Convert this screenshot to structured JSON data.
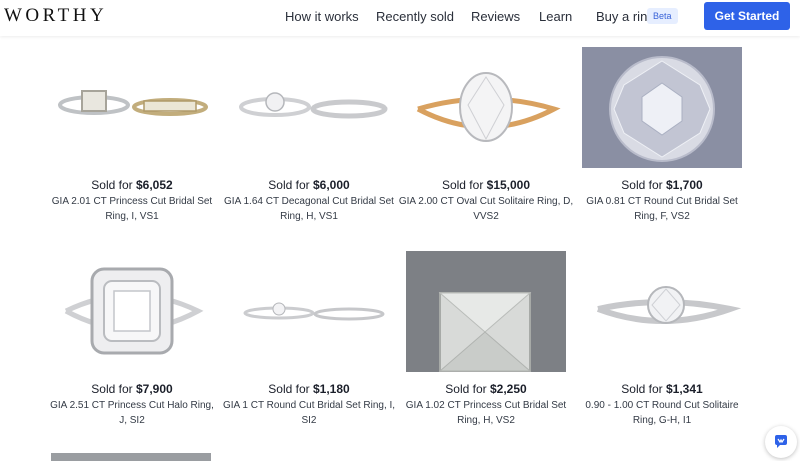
{
  "header": {
    "logo": "WORTHY",
    "nav": [
      "How it works",
      "Recently sold",
      "Reviews",
      "Learn",
      "Buy a ring"
    ],
    "beta": "Beta",
    "cta": "Get Started"
  },
  "sold_prefix": "Sold for",
  "listings": [
    {
      "price": "$6,052",
      "line1": "GIA 2.01 CT Princess Cut Bridal Set",
      "line2": "Ring, I, VS1"
    },
    {
      "price": "$6,000",
      "line1": "GIA 1.64 CT Decagonal Cut Bridal Set",
      "line2": "Ring, H, VS1"
    },
    {
      "price": "$15,000",
      "line1": "GIA 2.00 CT Oval Cut Solitaire Ring, D,",
      "line2": "VVS2"
    },
    {
      "price": "$1,700",
      "line1": "GIA 0.81 CT Round Cut Bridal Set",
      "line2": "Ring, F, VS2"
    },
    {
      "price": "$7,900",
      "line1": "GIA 2.51 CT Princess Cut Halo Ring,",
      "line2": "J, SI2"
    },
    {
      "price": "$1,180",
      "line1": "GIA 1 CT Round Cut Bridal Set Ring, I,",
      "line2": "SI2"
    },
    {
      "price": "$2,250",
      "line1": "GIA 1.02 CT Princess Cut Bridal Set",
      "line2": "Ring, H, VS2"
    },
    {
      "price": "$1,341",
      "line1": "0.90 - 1.00 CT Round Cut Solitaire",
      "line2": "Ring, G-H, I1"
    }
  ],
  "colors": {
    "accent": "#2e62e8",
    "beta_bg": "#e6eeff"
  },
  "icons": {
    "chat": "chat-bubble-icon"
  }
}
